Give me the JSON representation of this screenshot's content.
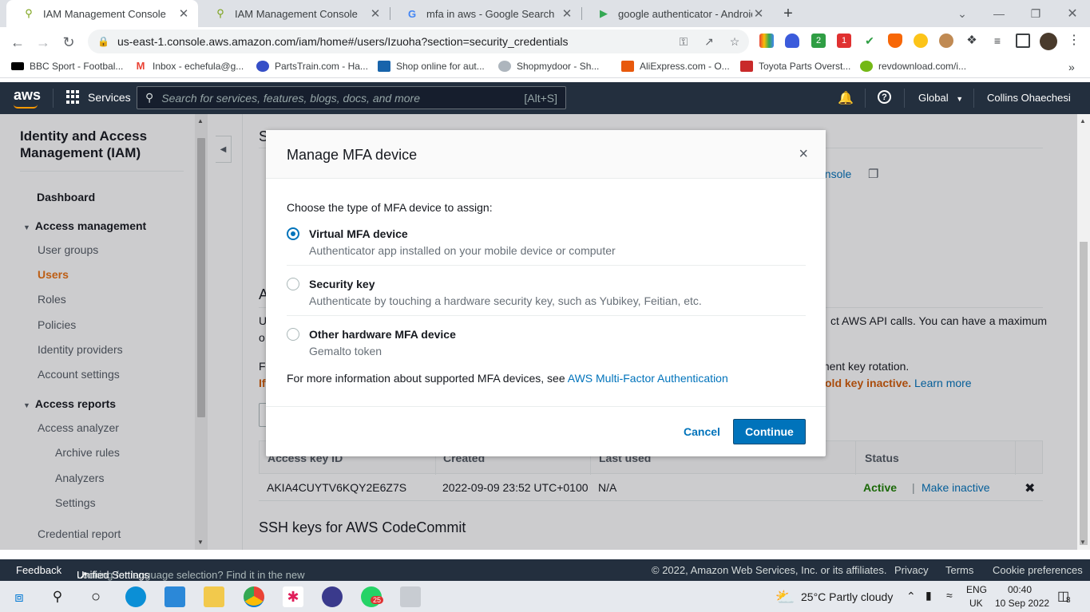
{
  "browser": {
    "tabs": [
      {
        "title": "IAM Management Console",
        "active": true
      },
      {
        "title": "IAM Management Console",
        "active": false
      },
      {
        "title": "mfa in aws - Google Search",
        "active": false
      },
      {
        "title": "google authenticator - Android A",
        "active": false
      }
    ],
    "url": "us-east-1.console.aws.amazon.com/iam/home#/users/Izuoha?section=security_credentials",
    "bookmarks": [
      "BBC Sport - Footbal...",
      "Inbox - echefula@g...",
      "PartsTrain.com - Ha...",
      "Shop online for aut...",
      "Shopmydoor - Sh...",
      "AliExpress.com - O...",
      "Toyota Parts Overst...",
      "revdownload.com/i..."
    ]
  },
  "aws_header": {
    "logo": "aws",
    "services_label": "Services",
    "search_placeholder": "Search for services, features, blogs, docs, and more",
    "search_hint": "[Alt+S]",
    "region": "Global",
    "user": "Collins Ohaechesi"
  },
  "sidenav": {
    "title": "Identity and Access Management (IAM)",
    "dashboard": "Dashboard",
    "access_management": "Access management",
    "user_groups": "User groups",
    "users": "Users",
    "roles": "Roles",
    "policies": "Policies",
    "identity_providers": "Identity providers",
    "account_settings": "Account settings",
    "access_reports": "Access reports",
    "access_analyzer": "Access analyzer",
    "archive_rules": "Archive rules",
    "analyzers": "Analyzers",
    "settings": "Settings",
    "credential_report": "Credential report"
  },
  "background": {
    "heading_s": "S",
    "console_link": "onsole",
    "heading_a": "A",
    "line_u": "U",
    "line_o": "o",
    "line_f": "F",
    "line_if": "If",
    "api_text": "ct AWS API calls. You can have a maximum",
    "rotation_text": "ment key rotation.",
    "inactive_warn": "old key inactive.",
    "learn_more": "Learn more",
    "table_headers": [
      "Access key ID",
      "Created",
      "Last used",
      "Status"
    ],
    "row": {
      "key_id": "AKIA4CUYTV6KQY2E6Z7S",
      "created": "2022-09-09 23:52 UTC+0100",
      "last_used": "N/A",
      "status": "Active",
      "action": "Make inactive"
    },
    "ssh_heading": "SSH keys for AWS CodeCommit"
  },
  "modal": {
    "title": "Manage MFA device",
    "prompt": "Choose the type of MFA device to assign:",
    "options": [
      {
        "label": "Virtual MFA device",
        "desc": "Authenticator app installed on your mobile device or computer",
        "selected": true
      },
      {
        "label": "Security key",
        "desc": "Authenticate by touching a hardware security key, such as Yubikey, Feitian, etc.",
        "selected": false
      },
      {
        "label": "Other hardware MFA device",
        "desc": "Gemalto token",
        "selected": false
      }
    ],
    "more_info_prefix": "For more information about supported MFA devices, see ",
    "more_info_link": "AWS Multi-Factor Authentication",
    "cancel": "Cancel",
    "continue": "Continue"
  },
  "footer": {
    "feedback": "Feedback",
    "lang_prefix": "Looking for language selection? Find it in the new ",
    "lang_link": "Unified Settings",
    "copyright": "© 2022, Amazon Web Services, Inc. or its affiliates.",
    "privacy": "Privacy",
    "terms": "Terms",
    "cookies": "Cookie preferences"
  },
  "taskbar": {
    "whatsapp_badge": "25",
    "weather": "25°C  Partly cloudy",
    "lang_top": "ENG",
    "lang_bottom": "UK",
    "time": "00:40",
    "date": "10 Sep 2022",
    "notif_count": "8"
  },
  "colors": {
    "aws_nav": "#232f3e",
    "link": "#0073bb",
    "primary_button": "#0073bb",
    "active_nav": "#ec7211",
    "status_active": "#1d8102",
    "warning": "#d45b07"
  }
}
